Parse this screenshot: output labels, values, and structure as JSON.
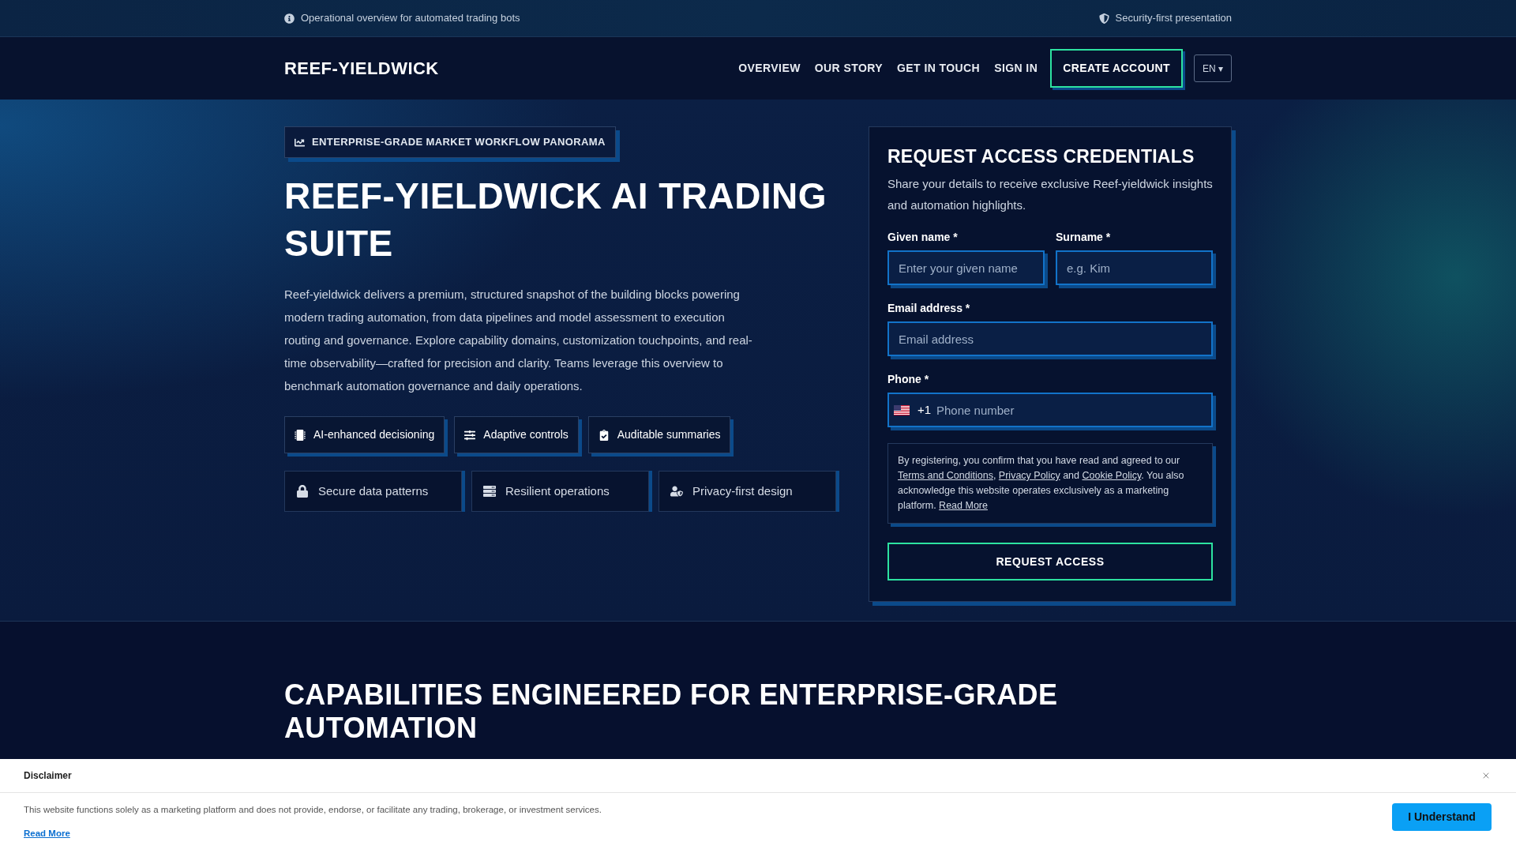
{
  "top_bar": {
    "left": "Operational overview for automated trading bots",
    "right": "Security-first presentation"
  },
  "nav": {
    "logo": "REEF-YIELDWICK",
    "links": [
      "OVERVIEW",
      "OUR STORY",
      "GET IN TOUCH",
      "SIGN IN"
    ],
    "cta": "CREATE ACCOUNT",
    "language": {
      "label": "EN",
      "caret": "▾"
    }
  },
  "hero": {
    "badge": "ENTERPRISE-GRADE MARKET WORKFLOW PANORAMA",
    "title": "REEF-YIELDWICK AI TRADING SUITE",
    "description": "Reef-yieldwick delivers a premium, structured snapshot of the building blocks powering modern trading automation, from data pipelines and model assessment to execution routing and governance. Explore capability domains, customization touchpoints, and real-time observability—crafted for precision and clarity. Teams leverage this overview to benchmark automation governance and daily operations.",
    "features": [
      "AI-enhanced decisioning",
      "Adaptive controls",
      "Auditable summaries"
    ],
    "assurances": [
      "Secure data patterns",
      "Resilient operations",
      "Privacy-first design"
    ]
  },
  "form": {
    "title": "REQUEST ACCESS CREDENTIALS",
    "subtitle": "Share your details to receive exclusive Reef-yieldwick insights and automation highlights.",
    "rows": [
      [
        {
          "kind": "text",
          "label": "Given name *",
          "placeholder": "Enter your given name"
        },
        {
          "kind": "text",
          "label": "Surname *",
          "placeholder": "e.g. Kim"
        }
      ],
      [
        {
          "kind": "email",
          "label": "Email address *",
          "placeholder": "Email address"
        }
      ],
      [
        {
          "kind": "phone",
          "label": "Phone *",
          "dial_code": "+1",
          "placeholder": "Phone number"
        }
      ]
    ],
    "consent": [
      {
        "kind": "text",
        "text": "By registering, you confirm that you have read and agreed to our "
      },
      {
        "kind": "link",
        "text": "Terms and Conditions"
      },
      {
        "kind": "text",
        "text": ", "
      },
      {
        "kind": "link",
        "text": "Privacy Policy"
      },
      {
        "kind": "text",
        "text": " and "
      },
      {
        "kind": "link",
        "text": "Cookie Policy"
      },
      {
        "kind": "text",
        "text": ". You also acknowledge this website operates exclusively as a marketing platform. "
      },
      {
        "kind": "link",
        "text": "Read More"
      }
    ],
    "submit": "REQUEST ACCESS"
  },
  "capabilities": {
    "heading": "CAPABILITIES ENGINEERED FOR ENTERPRISE-GRADE AUTOMATION"
  },
  "disclaimer": {
    "title": "Disclaimer",
    "text": "This website functions solely as a marketing platform and does not provide, endorse, or facilitate any trading, brokerage, or investment services.",
    "link": "Read More",
    "button": "I Understand"
  }
}
